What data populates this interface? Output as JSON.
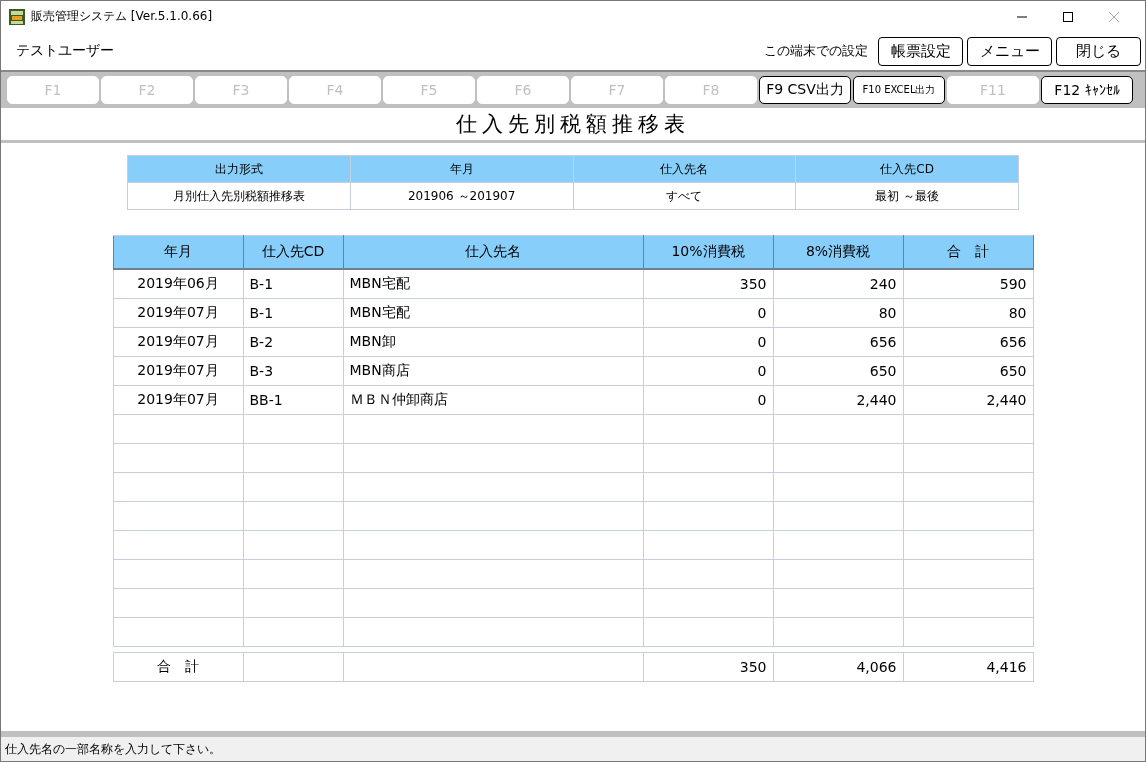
{
  "window": {
    "title": "販売管理システム [Ver.5.1.0.66]"
  },
  "header": {
    "user": "テストユーザー",
    "settings_label": "この端末での設定",
    "buttons": [
      "帳票設定",
      "メニュー",
      "閉じる"
    ]
  },
  "function_keys": [
    {
      "label": "F1",
      "disabled": true
    },
    {
      "label": "F2",
      "disabled": true
    },
    {
      "label": "F3",
      "disabled": true
    },
    {
      "label": "F4",
      "disabled": true
    },
    {
      "label": "F5",
      "disabled": true
    },
    {
      "label": "F6",
      "disabled": true
    },
    {
      "label": "F7",
      "disabled": true
    },
    {
      "label": "F8",
      "disabled": true
    },
    {
      "label": "F9 CSV出力",
      "disabled": false,
      "kind": "normal"
    },
    {
      "label": "F10 EXCEL出力",
      "disabled": false,
      "kind": "small"
    },
    {
      "label": "F11",
      "disabled": true
    },
    {
      "label": "F12 ｷｬﾝｾﾙ",
      "disabled": false,
      "kind": "normal"
    }
  ],
  "report_title": "仕入先別税額推移表",
  "conditions": {
    "columns": [
      "出力形式",
      "年月",
      "仕入先名",
      "仕入先CD"
    ],
    "values": [
      "月別仕入先別税額推移表",
      "201906 ～201907",
      "すべて",
      "最初 ～最後"
    ]
  },
  "table": {
    "columns": [
      "年月",
      "仕入先CD",
      "仕入先名",
      "10%消費税",
      "8%消費税",
      "合　計"
    ],
    "rows": [
      [
        "2019年06月",
        "B-1",
        "MBN宅配",
        "350",
        "240",
        "590"
      ],
      [
        "2019年07月",
        "B-1",
        "MBN宅配",
        "0",
        "80",
        "80"
      ],
      [
        "2019年07月",
        "B-2",
        "MBN卸",
        "0",
        "656",
        "656"
      ],
      [
        "2019年07月",
        "B-3",
        "MBN商店",
        "0",
        "650",
        "650"
      ],
      [
        "2019年07月",
        "BB-1",
        "ＭＢＮ仲卸商店",
        "0",
        "2,440",
        "2,440"
      ]
    ],
    "total": {
      "label": "合　計",
      "tax_10": "350",
      "tax_8": "4,066",
      "sum": "4,416"
    }
  },
  "status_bar": "仕入先名の一部名称を入力して下さい。"
}
